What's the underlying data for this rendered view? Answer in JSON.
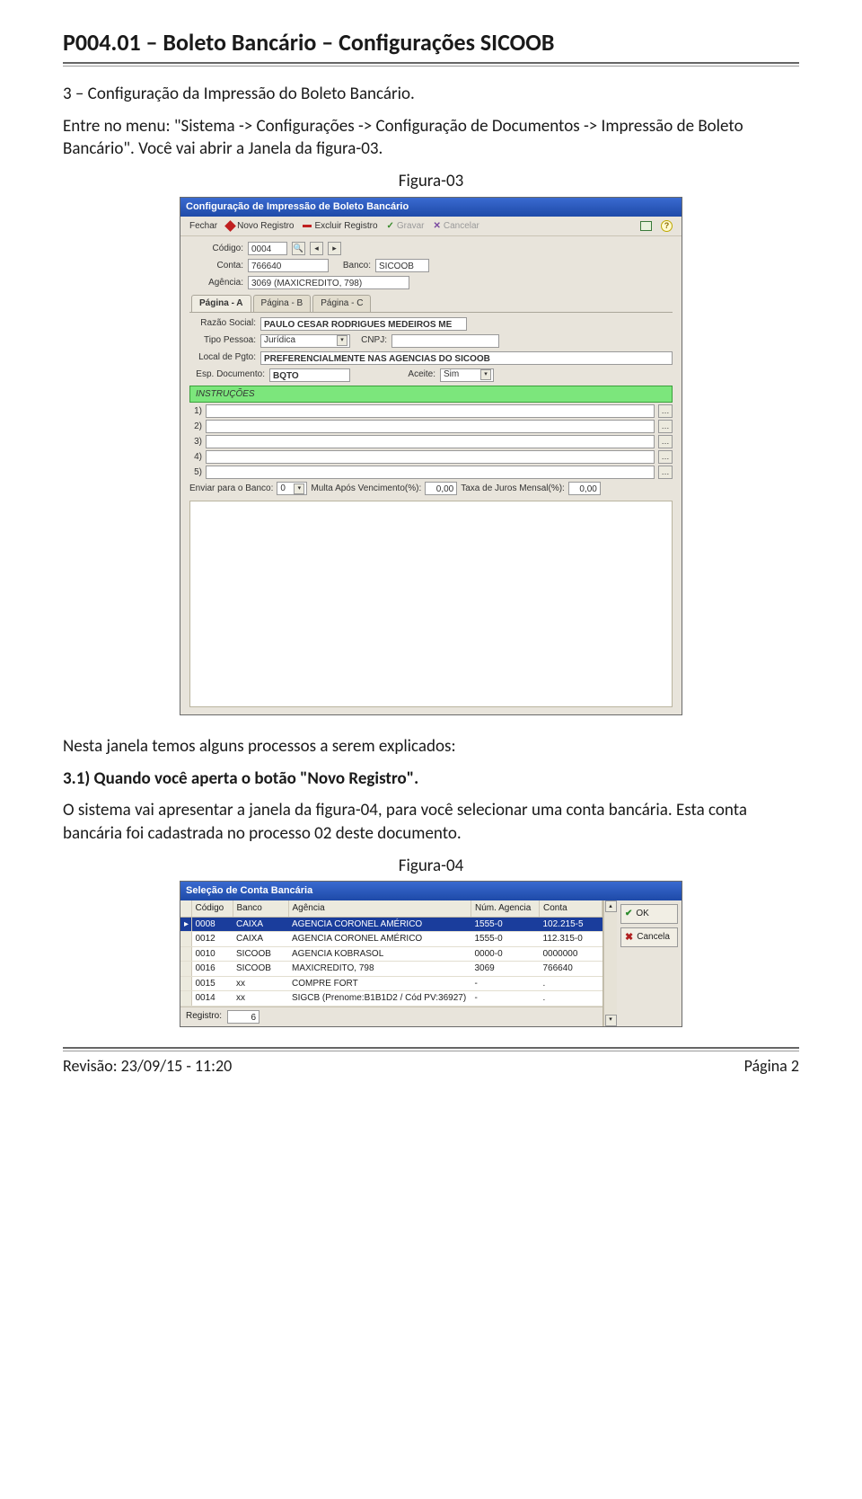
{
  "doc": {
    "title": "P004.01 – Boleto Bancário – Configurações SICOOB",
    "section_heading": "3 – Configuração da Impressão do Boleto Bancário.",
    "para1": "Entre no menu: \"Sistema -> Configurações -> Configuração de Documentos -> Impressão de Boleto Bancário\". Você vai abrir a Janela da figura-03.",
    "figure3_label": "Figura-03",
    "para2": "Nesta janela temos alguns processos a serem explicados:",
    "sub31": "3.1) Quando você aperta o botão \"Novo Registro\".",
    "para3": "O sistema vai apresentar a janela da figura-04, para você selecionar uma conta bancária. Esta conta bancária foi cadastrada no processo 02 deste documento.",
    "figure4_label": "Figura-04",
    "footer_left": "Revisão: 23/09/15 - 11:20",
    "footer_right": "Página 2"
  },
  "fig3": {
    "window_title": "Configuração de Impressão de Boleto Bancário",
    "toolbar": {
      "fechar": "Fechar",
      "novo": "Novo Registro",
      "excluir": "Excluir Registro",
      "gravar": "Gravar",
      "cancelar": "Cancelar"
    },
    "labels": {
      "codigo": "Código:",
      "conta": "Conta:",
      "banco": "Banco:",
      "agencia": "Agência:",
      "razao": "Razão Social:",
      "tipo_pessoa": "Tipo Pessoa:",
      "cnpj": "CNPJ:",
      "local_pgto": "Local de Pgto:",
      "esp_doc": "Esp. Documento:",
      "aceite": "Aceite:",
      "instrucoes": "INSTRUÇÕES",
      "enviar_banco": "Enviar para o Banco:",
      "multa_pos": "Multa Após Vencimento(%):",
      "taxa_juros": "Taxa de Juros Mensal(%):"
    },
    "fields": {
      "codigo": "0004",
      "conta": "766640",
      "banco": "SICOOB",
      "agencia": "3069 (MAXICREDITO, 798)",
      "razao": "PAULO CESAR RODRIGUES MEDEIROS ME",
      "tipo_pessoa": "Jurídica",
      "cnpj": "",
      "local_pgto": "PREFERENCIALMENTE NAS AGENCIAS DO SICOOB",
      "esp_doc": "BQTO",
      "aceite": "Sim",
      "enviar_banco": "0",
      "multa_pos": "0,00",
      "taxa_juros": "0,00"
    },
    "tabs": [
      "Página - A",
      "Página - B",
      "Página - C"
    ],
    "instr_nums": [
      "1)",
      "2)",
      "3)",
      "4)",
      "5)"
    ]
  },
  "fig4": {
    "window_title": "Seleção de Conta Bancária",
    "buttons": {
      "ok": "OK",
      "cancela": "Cancela"
    },
    "headers": [
      "",
      "Código",
      "Banco",
      "Agência",
      "Núm. Agencia",
      "Conta"
    ],
    "rows": [
      {
        "codigo": "0008",
        "banco": "CAIXA",
        "agencia": "AGENCIA CORONEL AMÉRICO",
        "num": "1555-0",
        "conta": "102.215-5",
        "selected": true
      },
      {
        "codigo": "0012",
        "banco": "CAIXA",
        "agencia": "AGENCIA CORONEL AMÉRICO",
        "num": "1555-0",
        "conta": "112.315-0"
      },
      {
        "codigo": "0010",
        "banco": "SICOOB",
        "agencia": "AGENCIA KOBRASOL",
        "num": "0000-0",
        "conta": "0000000"
      },
      {
        "codigo": "0016",
        "banco": "SICOOB",
        "agencia": "MAXICREDITO, 798",
        "num": "3069",
        "conta": "766640"
      },
      {
        "codigo": "0015",
        "banco": "xx",
        "agencia": "COMPRE FORT",
        "num": "-",
        "conta": "."
      },
      {
        "codigo": "0014",
        "banco": "xx",
        "agencia": "SIGCB (Prenome:B1B1D2 / Cód PV:36927)",
        "num": "-",
        "conta": "."
      }
    ],
    "status_label": "Registro:",
    "status_value": "6"
  }
}
